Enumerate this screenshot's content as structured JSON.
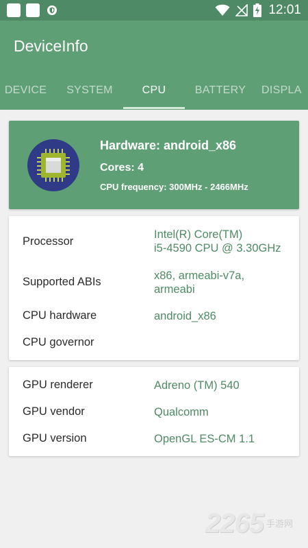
{
  "status_bar": {
    "time": "12:01",
    "icons": [
      "app-square-icon",
      "app-square-icon",
      "shield-icon",
      "wifi-icon",
      "signal-off-icon",
      "battery-charging-icon"
    ]
  },
  "app_bar": {
    "title": "DeviceInfo",
    "tabs": [
      {
        "label": "DEVICE"
      },
      {
        "label": "SYSTEM"
      },
      {
        "label": "CPU",
        "active": true
      },
      {
        "label": "BATTERY"
      },
      {
        "label": "DISPLA"
      }
    ]
  },
  "hero": {
    "icon": "cpu-chip-icon",
    "hardware": "Hardware: android_x86",
    "cores": "Cores: 4",
    "frequency": "CPU frequency: 300MHz - 2466MHz"
  },
  "cpu_info": {
    "rows": [
      {
        "label": "Processor",
        "value_lines": [
          "Intel(R) Core(TM)",
          "i5-4590 CPU @ 3.30GHz"
        ]
      },
      {
        "label": "Supported ABIs",
        "value_lines": [
          "x86, armeabi-v7a,",
          "armeabi"
        ]
      },
      {
        "label": "CPU hardware",
        "value_lines": [
          "android_x86"
        ]
      },
      {
        "label": "CPU governor",
        "value_lines": []
      }
    ]
  },
  "gpu_info": {
    "rows": [
      {
        "label": "GPU renderer",
        "value": "Adreno (TM) 540"
      },
      {
        "label": "GPU vendor",
        "value": "Qualcomm"
      },
      {
        "label": "GPU version",
        "value": "OpenGL ES-CM 1.1"
      }
    ]
  },
  "watermark": {
    "number": "2265",
    "text": "手游网"
  },
  "colors": {
    "status_bar": "#4f8a66",
    "primary": "#5e9f76",
    "value_text": "#4e8a63",
    "background": "#f0f0f0"
  }
}
